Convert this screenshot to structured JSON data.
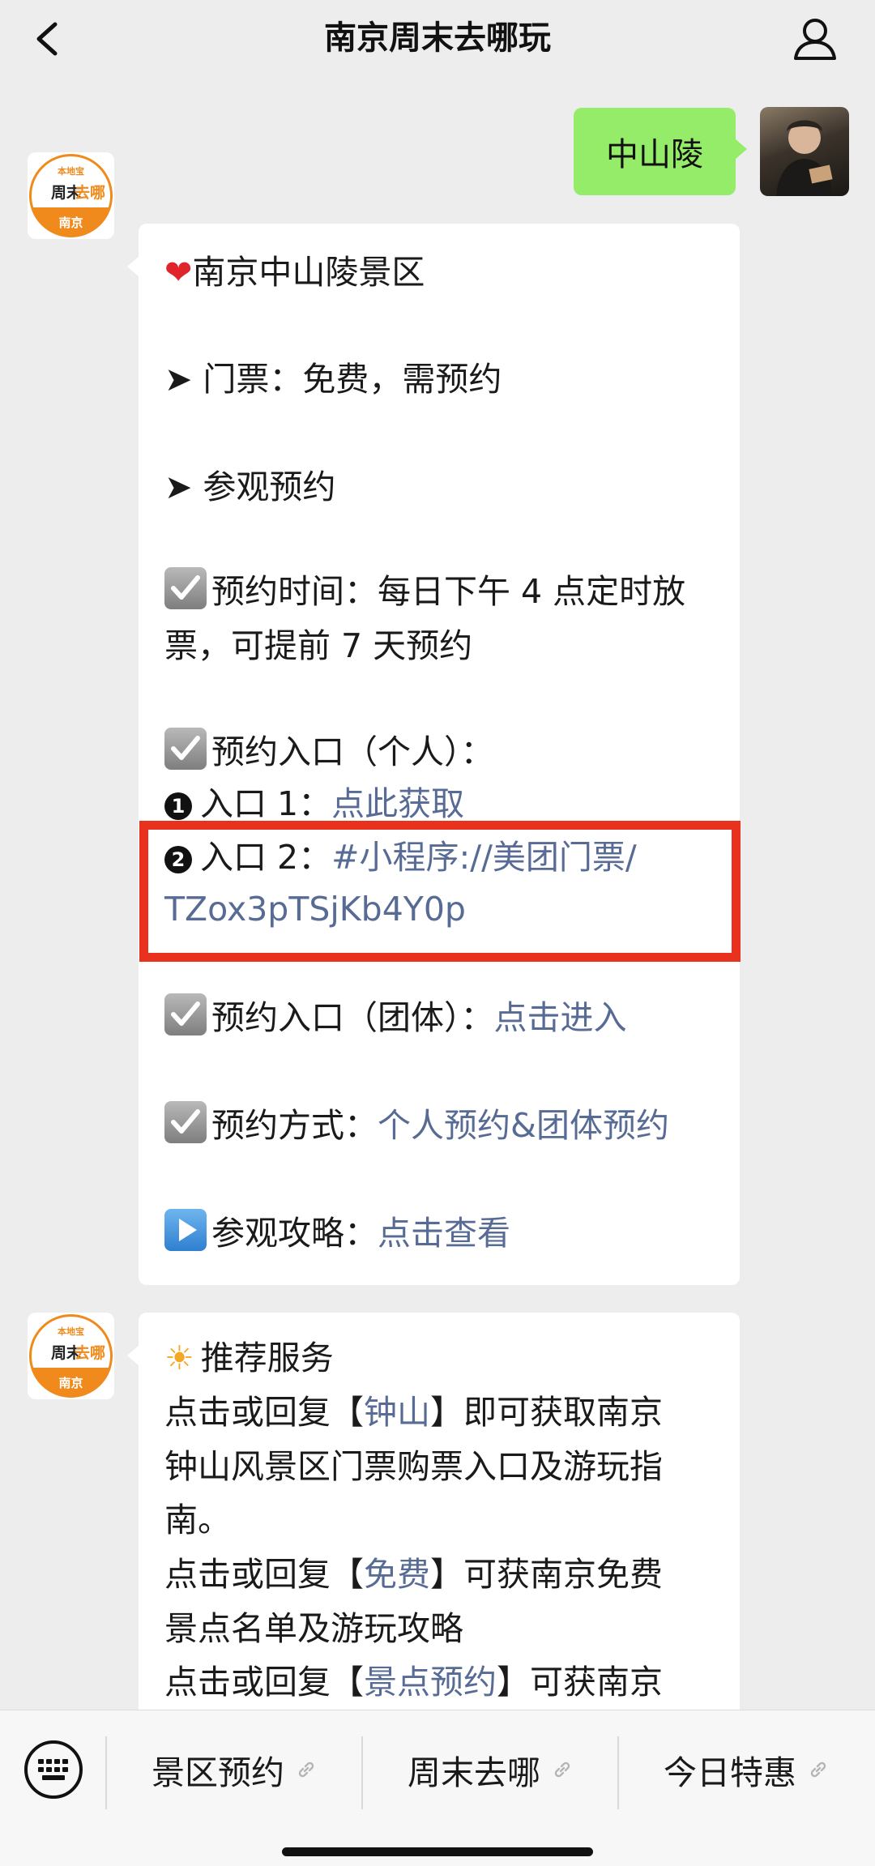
{
  "header": {
    "title": "南京周末去哪玩",
    "back_icon": "chevron-left-icon",
    "profile_icon": "person-icon"
  },
  "sent_message": {
    "text": "中山陵"
  },
  "bot_avatar": {
    "top_text": "本地宝",
    "main_text_a": "周末",
    "main_text_b": "去哪",
    "bottom_text": "南京",
    "accent": "#f08a1c"
  },
  "message1": {
    "heading": "南京中山陵景区",
    "ticket": "➤ 门票：免费，需预约",
    "visit": "➤ 参观预约",
    "time_line1": "预约时间：每日下午 4 点定时放",
    "time_line2": "票，可提前 7 天预约",
    "entry_personal": "预约入口（个人）：",
    "entry1_num": "1",
    "entry1_label": "入口 1：",
    "entry1_link": "点此获取",
    "entry2_num": "2",
    "entry2_label": "入口 2：",
    "entry2_link_line1": "#小程序://美团门票/",
    "entry2_link_line2": "TZox3pTSjKb4Y0p",
    "entry_group_label": "预约入口（团体）：",
    "entry_group_link": "点击进入",
    "method_label": "预约方式：",
    "method_link": "个人预约&团体预约",
    "guide_label": "参观攻略：",
    "guide_link": "点击查看"
  },
  "message2": {
    "heading": "推荐服务",
    "l1a": "点击或回复【",
    "l1b": "钟山",
    "l1c": "】即可获取南京",
    "l2": "钟山风景区门票购票入口及游玩指",
    "l3": "南。",
    "l4a": "点击或回复【",
    "l4b": "免费",
    "l4c": "】可获南京免费",
    "l5": "景点名单及游玩攻略",
    "l6a": "点击或回复【",
    "l6b": "景点预约",
    "l6c": "】可获南京"
  },
  "bottom_menu": {
    "keyboard_icon": "keyboard-icon",
    "items": [
      {
        "label": "景区预约"
      },
      {
        "label": "周末去哪"
      },
      {
        "label": "今日特惠"
      }
    ]
  },
  "colors": {
    "link": "#576b95",
    "sent_bubble": "#95ec69",
    "highlight": "#e8321e",
    "background": "#ededed"
  }
}
